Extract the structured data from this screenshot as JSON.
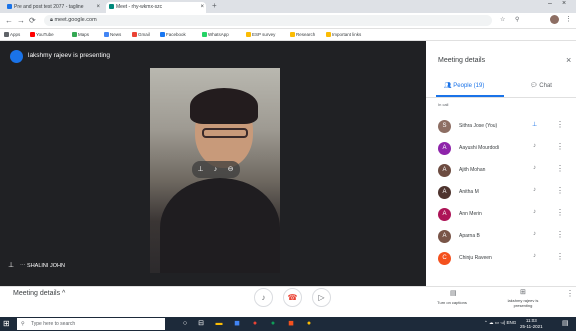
{
  "browser": {
    "tabs": [
      {
        "title": "Pre and post test 2077 - tagline",
        "active": false
      },
      {
        "title": "Meet - rhy-wkmx-szc",
        "active": true
      }
    ],
    "url": "meet.google.com",
    "bookmarks": [
      "Apps",
      "YouTube",
      "Maps",
      "News",
      "Gmail",
      "Facebook",
      "WhatsApp",
      "ESP survey",
      "Research",
      "Important links"
    ]
  },
  "meet": {
    "presenting_text": "lakshmy rajeev is presenting",
    "self_label": "SHALINI JOHN",
    "meeting_details_label": "Meeting details",
    "turn_on_captions_label": "Turn on captions",
    "presenting_label": "lakshmy rajeev is presenting"
  },
  "panel": {
    "title": "Meeting details",
    "tab_people": "People (19)",
    "tab_chat": "Chat",
    "in_call_label": "In call",
    "participants": [
      {
        "name": "Sithra Jose (You)",
        "color": "#8d6e63",
        "initial": "S"
      },
      {
        "name": "Aayushi Mourdodi",
        "color": "#8e24aa",
        "initial": "A"
      },
      {
        "name": "Ajith Mohan",
        "color": "#6d4c41",
        "initial": "A"
      },
      {
        "name": "Anitha M",
        "color": "#4e342e",
        "initial": "A"
      },
      {
        "name": "Ann Merin",
        "color": "#ad1457",
        "initial": "A"
      },
      {
        "name": "Aparna B",
        "color": "#795548",
        "initial": "A"
      },
      {
        "name": "Chinju Raveen",
        "color": "#f4511e",
        "initial": "C"
      }
    ]
  },
  "taskbar": {
    "search_placeholder": "Type here to search",
    "time": "11:03",
    "date": "25-11-2021",
    "tray_text": "ENG"
  },
  "colors": {
    "accent": "#1a73e8",
    "end_call": "#ea4335",
    "stage": "#202124"
  }
}
